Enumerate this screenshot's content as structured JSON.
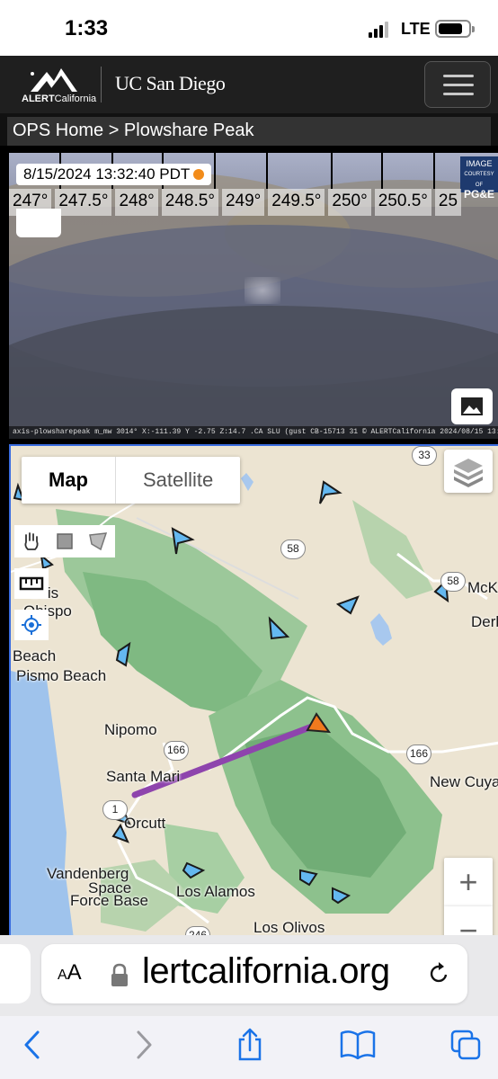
{
  "status_bar": {
    "time": "1:33",
    "network": "LTE"
  },
  "header": {
    "logo_prefix": "ALERT",
    "logo_suffix": "California",
    "partner": "UC San Diego",
    "menu_icon": "hamburger-menu-icon"
  },
  "breadcrumb": {
    "text": "OPS Home > Plowshare Peak"
  },
  "camera": {
    "timestamp": "8/15/2024 13:32:40 PDT",
    "status_color": "#f28c1a",
    "headings": [
      "247°",
      "247.5°",
      "248°",
      "248.5°",
      "249°",
      "249.5°",
      "250°",
      "250.5°",
      "25"
    ],
    "courtesy": [
      "IMAGE",
      "COURTESY OF",
      "PG&E"
    ],
    "caption": "axis-plowsharepeak m_mw 3014° X:-111.39 Y -2.75 Z:14.7 .CA SLU (gust CB-15713 31 © ALERTCalifornia 2024/08/15 13:32:40.54",
    "gallery_icon": "image-gallery-icon"
  },
  "map": {
    "type_map": "Map",
    "type_satellite": "Satellite",
    "zoom_in": "+",
    "zoom_out": "−",
    "places": {
      "san_luis": "Luis",
      "obispo": "Obispo",
      "beach": "Beach",
      "pismo": "Pismo Beach",
      "nipomo": "Nipomo",
      "santa_maria": "Santa Mari",
      "orcutt": "Orcutt",
      "vandenberg": "Vandenberg",
      "space": "Space",
      "force_base": "Force Base",
      "los_alamos": "Los Alamos",
      "los_olivos": "Los Olivos",
      "new_cuyama": "New Cuya",
      "mckittrick": "McKi",
      "derby": "Derb"
    },
    "shields": [
      "33",
      "58",
      "58",
      "58",
      "166",
      "166",
      "1",
      "246"
    ],
    "colors": {
      "camera_marker": "#f07a1e",
      "view_line": "#8e44ad",
      "aircraft": "#64b8f0"
    }
  },
  "browser": {
    "aa_label_small": "A",
    "aa_label": "A",
    "url": "lertcalifornia.org"
  }
}
